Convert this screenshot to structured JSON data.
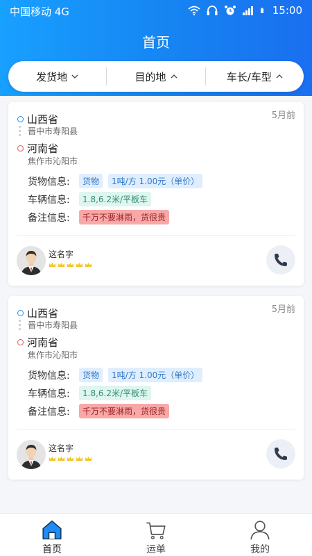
{
  "status_bar": {
    "carrier": "中国移动 4G",
    "time": "15:00"
  },
  "header": {
    "title": "首页"
  },
  "filters": [
    {
      "label": "发货地",
      "chevron": "chevron-down-icon"
    },
    {
      "label": "目的地",
      "chevron": "chevron-up-icon"
    },
    {
      "label": "车长/车型",
      "chevron": "chevron-up-icon"
    }
  ],
  "cards": [
    {
      "time": "5月前",
      "origin": {
        "province": "山西省",
        "city": "晋中市寿阳县"
      },
      "destination": {
        "province": "河南省",
        "city": "焦作市沁阳市"
      },
      "cargo_label": "货物信息:",
      "cargo_tags": [
        "货物",
        "1吨/方 1.00元（单价）"
      ],
      "vehicle_label": "车辆信息:",
      "vehicle_tag": "1.8,6.2米/平板车",
      "remark_label": "备注信息:",
      "remark_tag": "千万不要淋雨，货很贵",
      "user_name": "这名字",
      "rating": 5
    },
    {
      "time": "5月前",
      "origin": {
        "province": "山西省",
        "city": "晋中市寿阳县"
      },
      "destination": {
        "province": "河南省",
        "city": "焦作市沁阳市"
      },
      "cargo_label": "货物信息:",
      "cargo_tags": [
        "货物",
        "1吨/方 1.00元（单价）"
      ],
      "vehicle_label": "车辆信息:",
      "vehicle_tag": "1.8,6.2米/平板车",
      "remark_label": "备注信息:",
      "remark_tag": "千万不要淋雨，货很贵",
      "user_name": "这名字",
      "rating": 5
    }
  ],
  "tabbar": [
    {
      "label": "首页",
      "icon": "home-icon",
      "active": true
    },
    {
      "label": "运单",
      "icon": "cart-icon",
      "active": false
    },
    {
      "label": "我的",
      "icon": "user-icon",
      "active": false
    }
  ],
  "colors": {
    "accent": "#1684f2",
    "star": "#f3c623",
    "remark_bg": "#f7a8a8"
  }
}
